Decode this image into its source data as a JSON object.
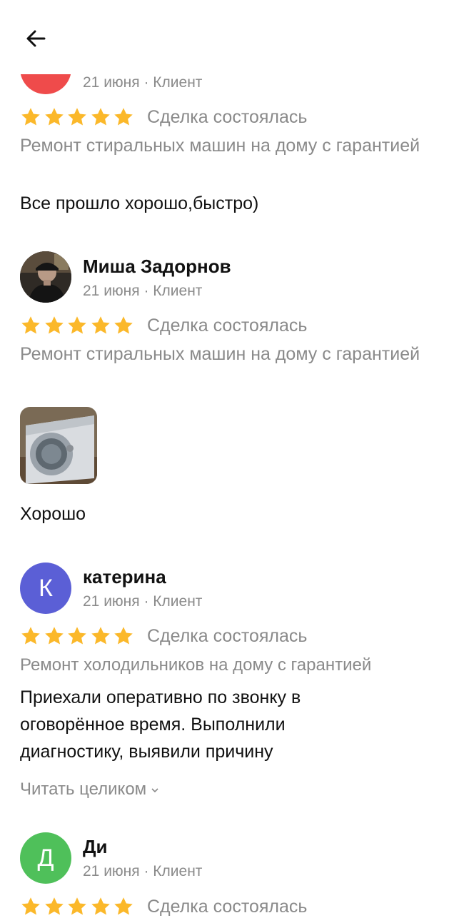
{
  "header": {
    "back_icon": "arrow-left-icon"
  },
  "reviews": [
    {
      "meta": "21 июня · Клиент",
      "rating": 5,
      "deal_status": "Сделка состоялась",
      "service": "Ремонт стиральных машин на дому с гарантией",
      "text": "Все прошло хорошо,быстро)",
      "avatar_color": "#ef4b4b"
    },
    {
      "name": "Миша Задорнов",
      "meta": "21 июня · Клиент",
      "rating": 5,
      "deal_status": "Сделка состоялась",
      "service": "Ремонт стиральных машин на дому с гарантией",
      "text": "Хорошо",
      "photo": "washing-machine-photo"
    },
    {
      "name": "катерина",
      "avatar_letter": "К",
      "avatar_color": "#5b5fd6",
      "meta": "21 июня · Клиент",
      "rating": 5,
      "deal_status": "Сделка состоялась",
      "service": "Ремонт холодильников на дому с гарантией",
      "text": "Приехали оперативно по звонку в оговорённое время. Выполнили диагностику, выявили причину",
      "read_more": "Читать целиком"
    },
    {
      "name": "Ди",
      "avatar_letter": "Д",
      "avatar_color": "#4fc05a",
      "meta": "21 июня · Клиент",
      "rating": 5,
      "deal_status": "Сделка состоялась"
    }
  ],
  "colors": {
    "star": "#fbb82a",
    "secondary_text": "#8a8a8a",
    "primary_text": "#111111"
  }
}
